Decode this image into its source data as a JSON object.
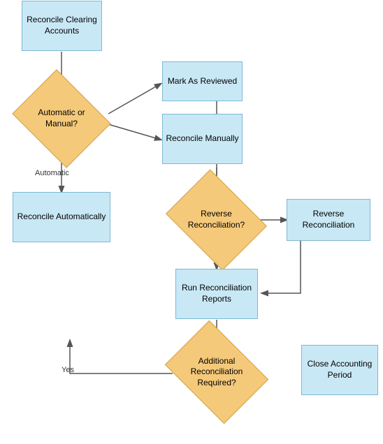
{
  "nodes": {
    "reconcile_clearing": {
      "label": "Reconcile Clearing Accounts"
    },
    "auto_or_manual": {
      "label": "Automatic or Manual?"
    },
    "automatic_label": {
      "label": "Automatic"
    },
    "mark_as_reviewed": {
      "label": "Mark As Reviewed"
    },
    "reconcile_manually": {
      "label": "Reconcile Manually"
    },
    "reconcile_automatically": {
      "label": "Reconcile Automatically"
    },
    "reverse_reconciliation_diamond": {
      "label": "Reverse Reconciliation?"
    },
    "reverse_reconciliation_box": {
      "label": "Reverse Reconciliation"
    },
    "run_reconciliation_reports": {
      "label": "Run Reconciliation Reports"
    },
    "additional_reconciliation": {
      "label": "Additional Reconciliation Required?"
    },
    "close_accounting_period": {
      "label": "Close Accounting Period"
    },
    "yes_label": {
      "label": "Yes"
    }
  }
}
